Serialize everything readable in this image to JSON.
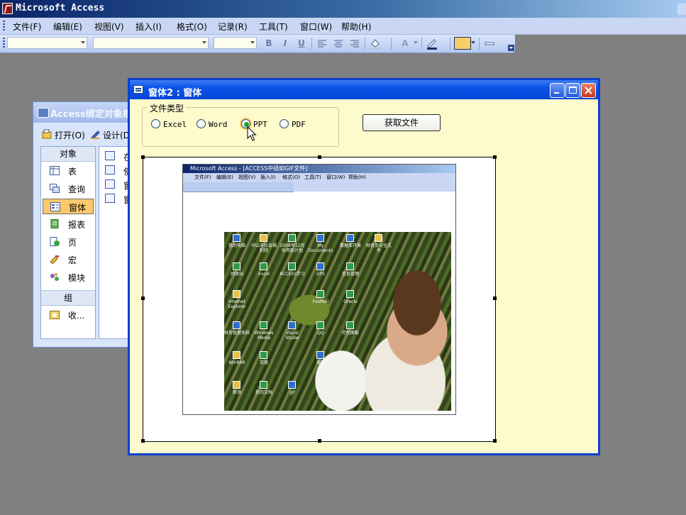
{
  "app": {
    "title": "Microsoft Access"
  },
  "menu": [
    "文件(F)",
    "编辑(E)",
    "视图(V)",
    "插入(I)",
    "格式(O)",
    "记录(R)",
    "工具(T)",
    "窗口(W)",
    "帮助(H)"
  ],
  "toolbar": {
    "bold": "B",
    "italic": "I",
    "underline": "U",
    "font_color_glyph": "A"
  },
  "db_window": {
    "title": "Access绑定对象框",
    "open_label": "打开(O)",
    "design_label": "设计(D)",
    "objects_header": "对象",
    "objects": [
      "表",
      "查询",
      "窗体",
      "报表",
      "页",
      "宏",
      "模块"
    ],
    "selected_object": "窗体",
    "groups_header": "组",
    "favorites": "收...",
    "list_items": [
      "在",
      "使",
      "窗",
      "窗"
    ]
  },
  "form_window": {
    "title": "窗体2 : 窗体",
    "group_label": "文件类型",
    "radio_options": [
      "Excel",
      "Word",
      "PPT",
      "PDF"
    ],
    "selected_option": "PPT",
    "get_file_button": "获取文件"
  },
  "embedded_screenshot": {
    "title": "Microsoft Access - [ACCESS中插如GIF文件]",
    "menu": [
      "文件(F)",
      "编辑(E)",
      "视图(V)",
      "插入(I)",
      "格式(O)",
      "工具(T)",
      "窗口(W)",
      "帮助(H)"
    ],
    "desktop_labels": [
      "我的电脑",
      "中山市社会福利院",
      "2008年12月份用款计划",
      "My Documents",
      "数据库开发",
      "财务及安全文件",
      "回收站",
      "Excel",
      "ACCESS学习",
      "UPS",
      "信息管理",
      "Internet Explorer",
      "FoxMail",
      "Oracle",
      "财务管理系统",
      "Windows Media",
      "Visual Studio",
      "QQ",
      "控制面板",
      "WinRAR",
      "百度",
      "搜狐",
      "新浪",
      "我的文档",
      "gif"
    ],
    "colors": {
      "accent": "#0a52e8",
      "photo_green": "#4d6a24"
    }
  }
}
